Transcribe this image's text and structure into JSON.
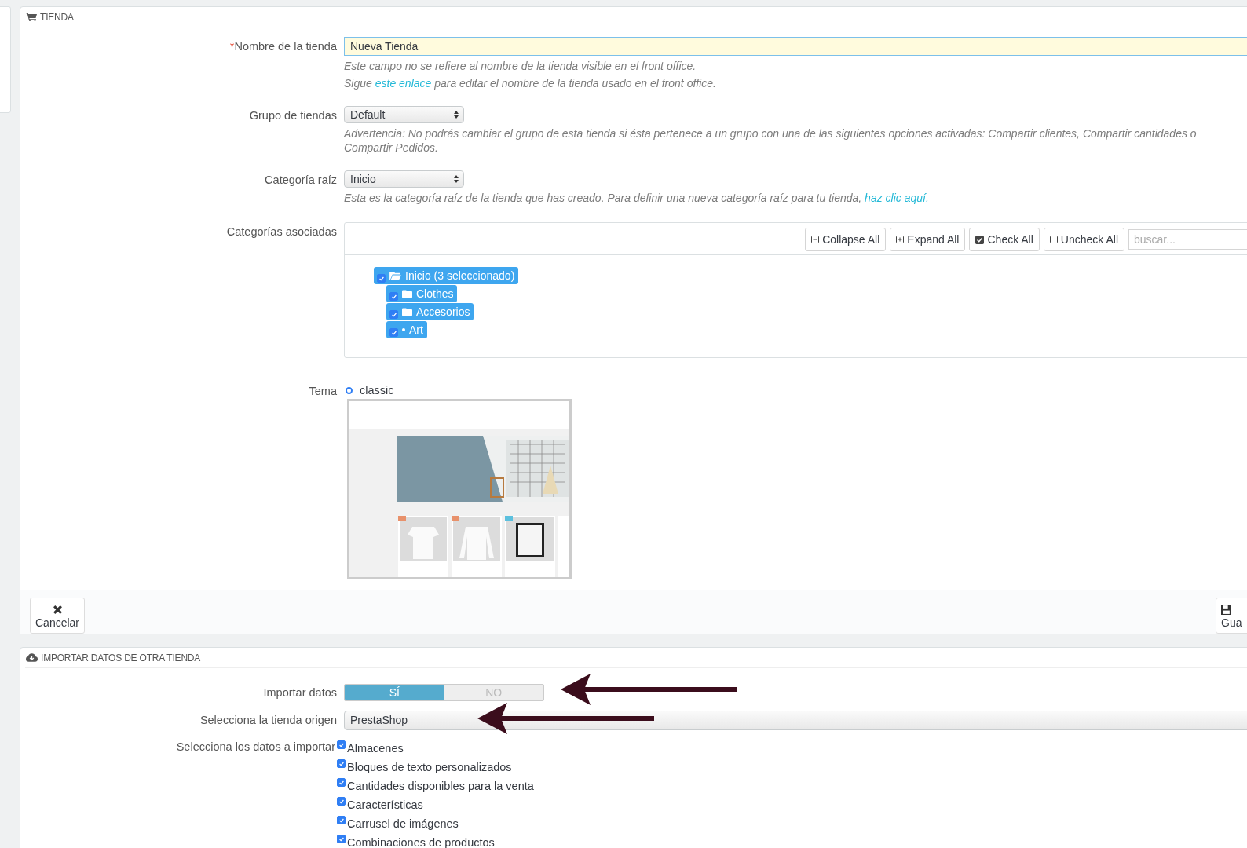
{
  "store_panel": {
    "title": "TIENDA",
    "name_field": {
      "label": "Nombre de la tienda",
      "required_mark": "*",
      "value": "Nueva Tienda",
      "help": [
        {
          "before": "Este campo no se refiere al nombre de la tienda visible en el front office."
        },
        {
          "before": "Sigue ",
          "link": "este enlace",
          "after": " para editar el nombre de la tienda usado en el front office."
        }
      ]
    },
    "group_field": {
      "label": "Grupo de tiendas",
      "value": "Default",
      "help": "Advertencia: No podrás cambiar el grupo de esta tienda si ésta pertenece a un grupo con una de las siguientes opciones activadas: Compartir clientes, Compartir cantidades o Compartir Pedidos."
    },
    "root_field": {
      "label": "Categoría raíz",
      "value": "Inicio",
      "help": {
        "before": "Esta es la categoría raíz de la tienda que has creado. Para definir una nueva categoría raíz para tu tienda, ",
        "link": "haz clic aquí."
      }
    },
    "categories": {
      "label": "Categorías asociadas",
      "toolbar": [
        {
          "kind": "collapse",
          "label": "Collapse All"
        },
        {
          "kind": "expand",
          "label": "Expand All"
        },
        {
          "kind": "check",
          "label": "Check All"
        },
        {
          "kind": "uncheck",
          "label": "Uncheck All"
        }
      ],
      "search": {
        "placeholder": "buscar..."
      },
      "tree": [
        {
          "label": "Inicio (3 seleccionado)",
          "kind": "folder-open",
          "checked": true,
          "children": [
            {
              "label": "Clothes",
              "kind": "folder",
              "checked": true
            },
            {
              "label": "Accesorios",
              "kind": "folder",
              "checked": true
            },
            {
              "label": "Art",
              "kind": "leaf",
              "checked": true
            }
          ]
        }
      ]
    },
    "theme": {
      "label": "Tema",
      "options": [
        {
          "label": "classic",
          "selected": true
        }
      ]
    },
    "footer": {
      "cancel": "Cancelar",
      "save": "Gua"
    }
  },
  "import_panel": {
    "title": "IMPORTAR DATOS DE OTRA TIENDA",
    "import_toggle": {
      "label": "Importar datos",
      "options": [
        {
          "label": "SÍ",
          "selected": true
        },
        {
          "label": "NO",
          "selected": false
        }
      ]
    },
    "source": {
      "label": "Selecciona la tienda origen",
      "value": "PrestaShop"
    },
    "data": {
      "label": "Selecciona los datos a importar",
      "items": [
        {
          "label": "Almacenes",
          "checked": true
        },
        {
          "label": "Bloques de texto personalizados",
          "checked": true
        },
        {
          "label": "Cantidades disponibles para la venta",
          "checked": true
        },
        {
          "label": "Características",
          "checked": true
        },
        {
          "label": "Carrusel de imágenes",
          "checked": true
        },
        {
          "label": "Combinaciones de productos",
          "checked": true
        }
      ]
    }
  }
}
